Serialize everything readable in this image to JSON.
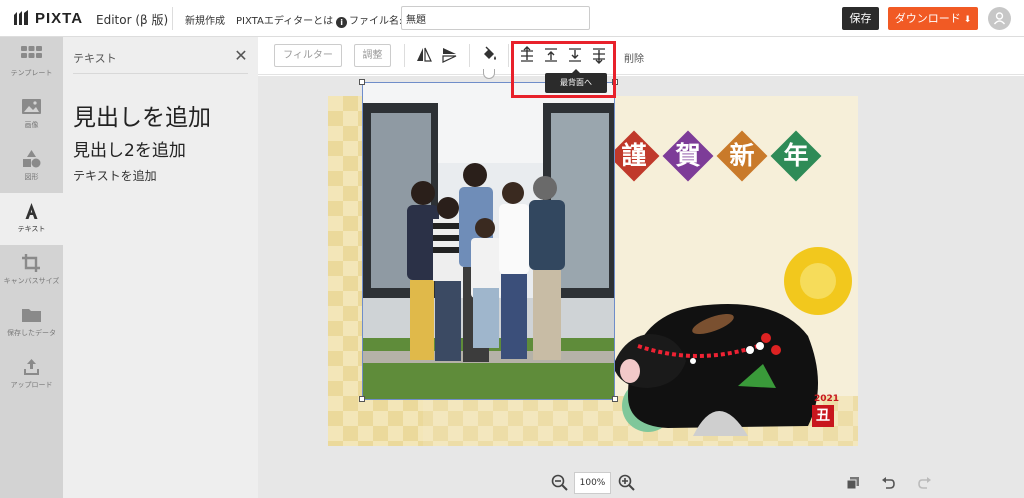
{
  "header": {
    "logo_text": "PIXTA",
    "editor_label": "Editor (β 版)",
    "new_label": "新規作成",
    "about_label": "PIXTAエディターとは",
    "filename_label": "ファイル名:",
    "filename_value": "無題",
    "save_label": "保存",
    "download_label": "ダウンロード"
  },
  "sidebar": {
    "items": [
      {
        "label": "テンプレート",
        "icon": "grid-icon"
      },
      {
        "label": "画像",
        "icon": "image-icon"
      },
      {
        "label": "図形",
        "icon": "shapes-icon"
      },
      {
        "label": "テキスト",
        "icon": "text-icon"
      },
      {
        "label": "キャンバスサイズ",
        "icon": "crop-icon"
      },
      {
        "label": "保存したデータ",
        "icon": "folder-icon"
      },
      {
        "label": "アップロード",
        "icon": "upload-icon"
      }
    ],
    "active_index": 3
  },
  "text_panel": {
    "title": "テキスト",
    "close_glyph": "✕",
    "add_heading": "見出しを追加",
    "add_heading2": "見出し2を追加",
    "add_text": "テキストを追加"
  },
  "toolbar": {
    "filter_label": "フィルター",
    "adjust_label": "調整",
    "delete_label": "削除",
    "tooltip": "最背面へ"
  },
  "canvas": {
    "kanji": [
      "謹",
      "賀",
      "新",
      "年"
    ],
    "year": "2021",
    "stamp": "丑",
    "colors": {
      "red": "#c0392b",
      "purple": "#7d3c98",
      "orange": "#c97a2a",
      "green": "#2e8b57"
    }
  },
  "zoom": {
    "value": "100%"
  },
  "colors": {
    "accent": "#f15a24",
    "dark": "#2b2b2b",
    "highlight": "#e8212b"
  }
}
